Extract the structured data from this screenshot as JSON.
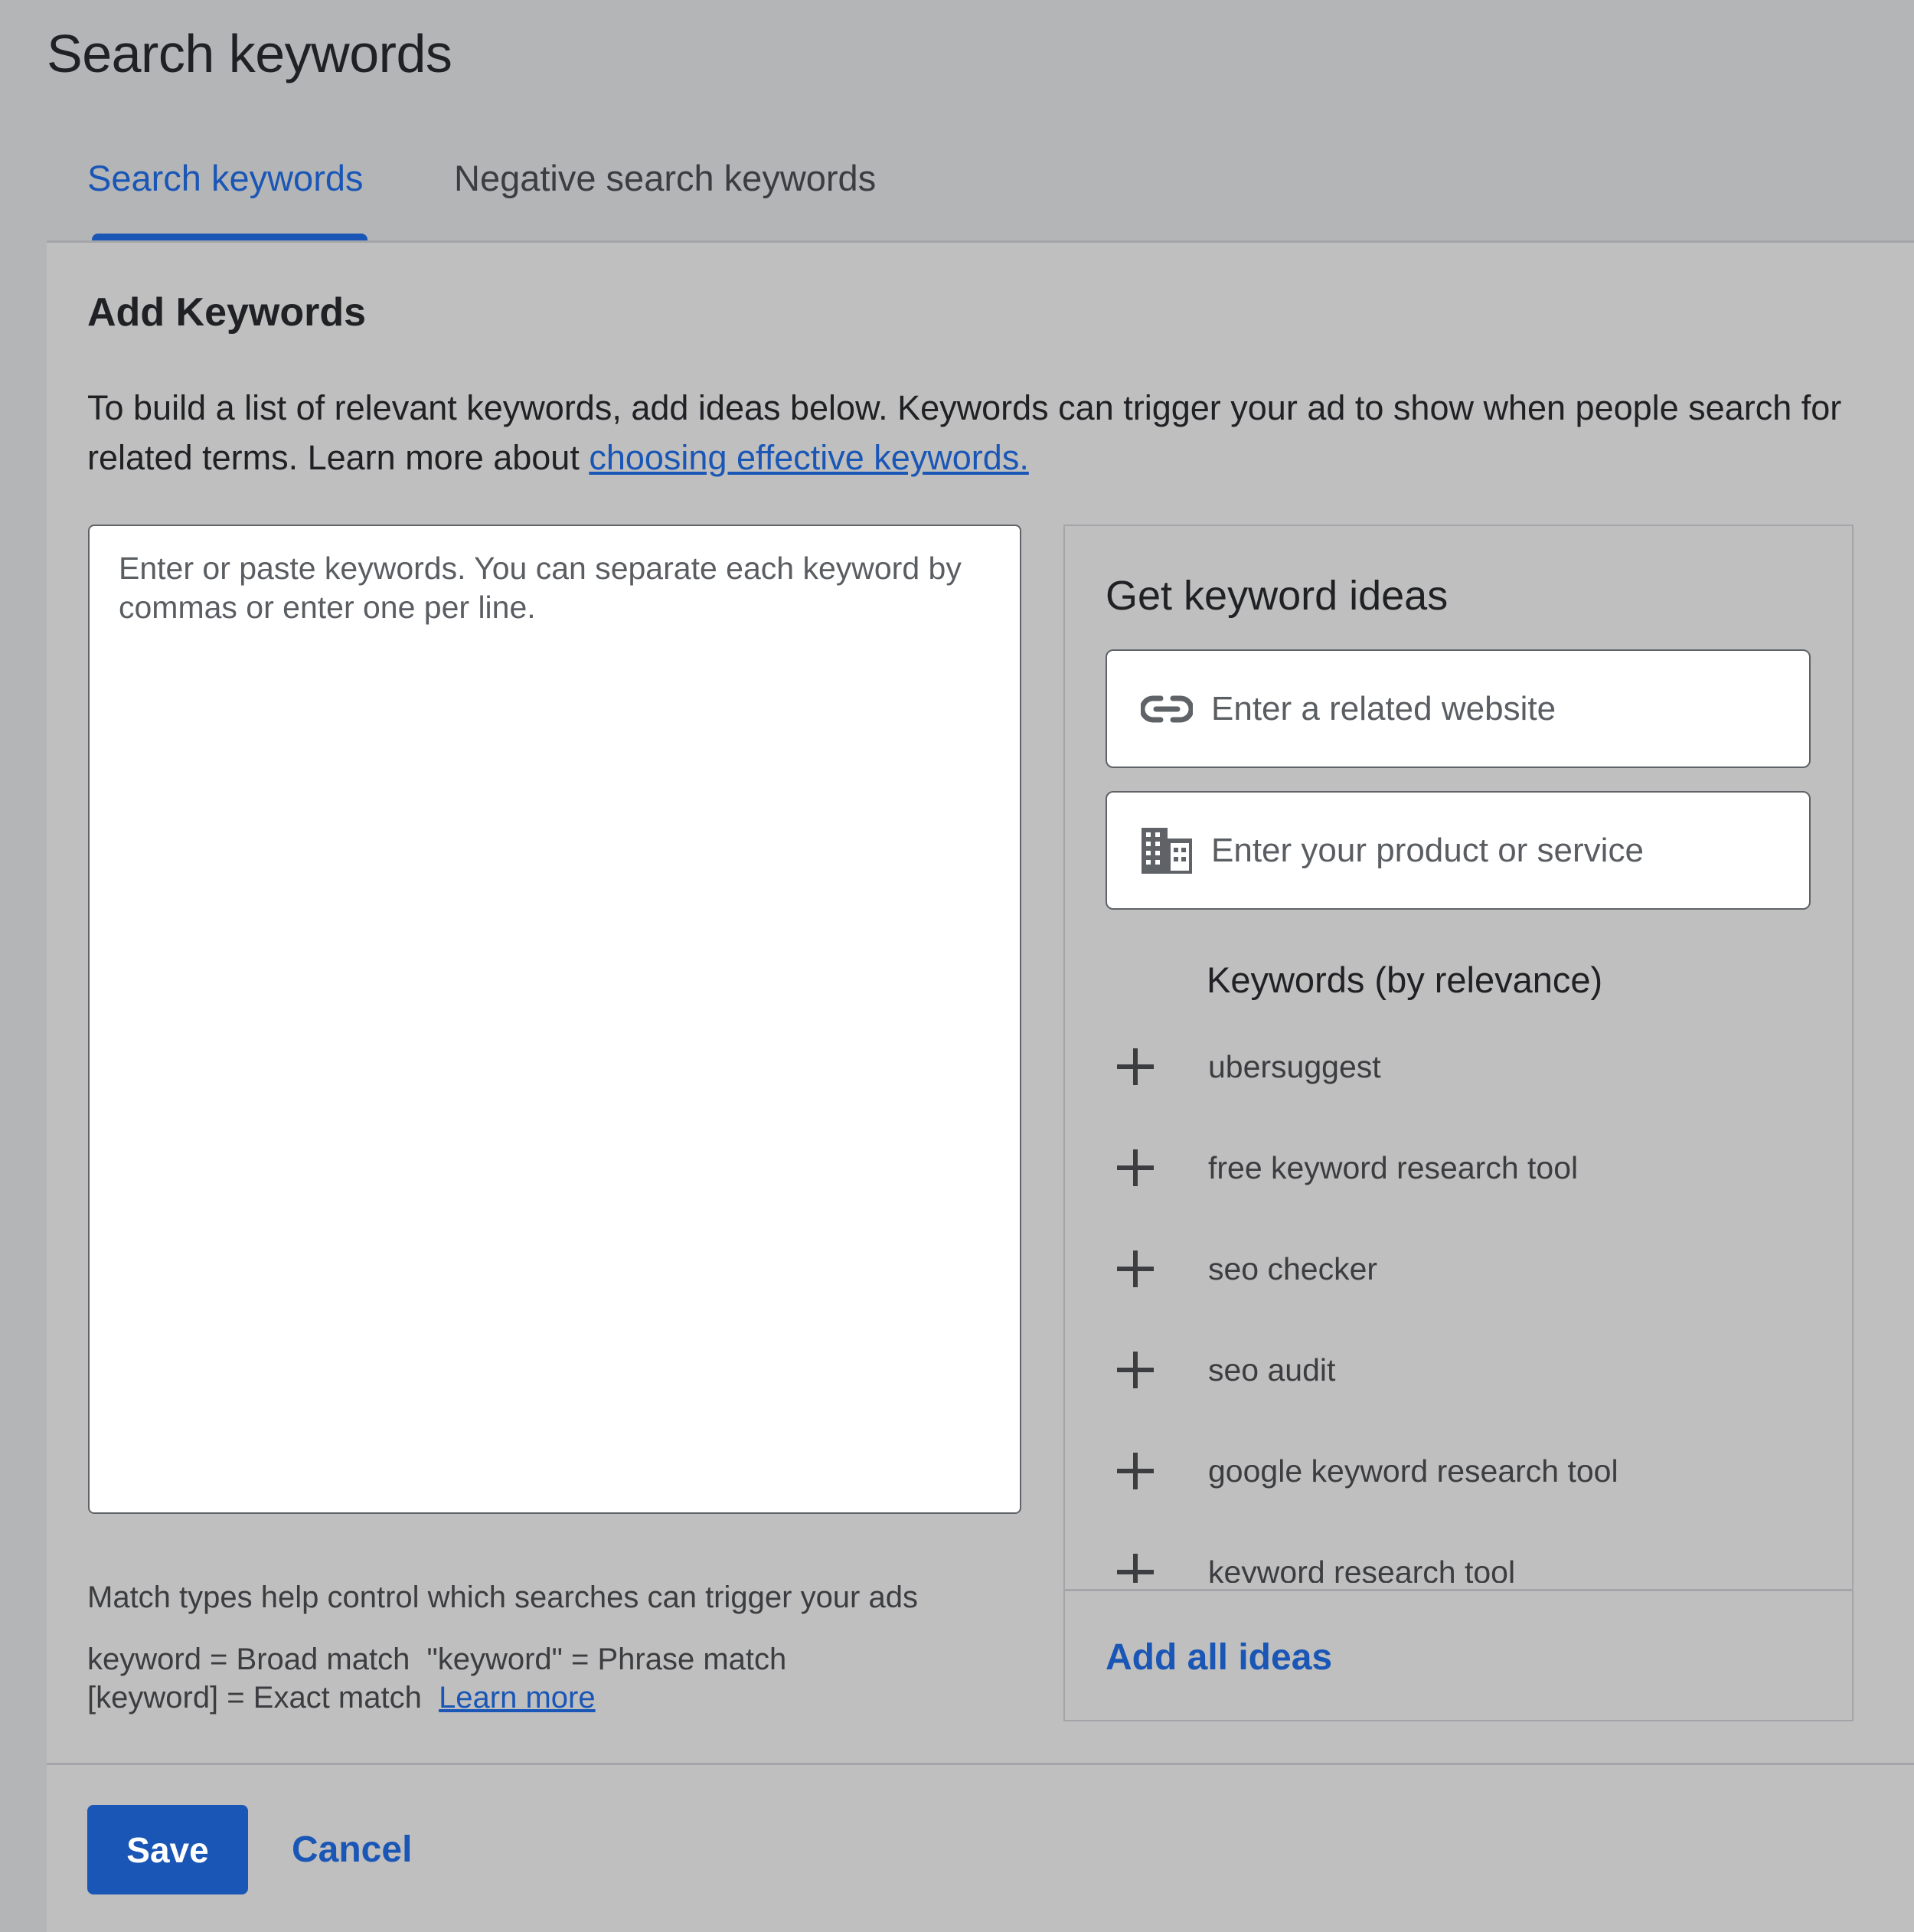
{
  "page": {
    "title": "Search keywords"
  },
  "tabs": [
    {
      "label": "Search keywords",
      "active": true
    },
    {
      "label": "Negative search keywords",
      "active": false
    }
  ],
  "add_keywords": {
    "title": "Add Keywords",
    "description_prefix": "To build a list of relevant keywords, add ideas below. Keywords can trigger your ad to show when people search for related terms. Learn more about ",
    "description_link": "choosing effective keywords.",
    "textarea": {
      "value": "",
      "placeholder": "Enter or paste keywords. You can separate each keyword by commas or enter one per line."
    }
  },
  "keyword_ideas": {
    "title": "Get keyword ideas",
    "website_input": {
      "value": "",
      "placeholder": "Enter a related website",
      "icon": "link-icon"
    },
    "product_input": {
      "value": "",
      "placeholder": "Enter your product or service",
      "icon": "building-icon"
    },
    "list_header": "Keywords (by relevance)",
    "keywords": [
      {
        "text": "ubersuggest",
        "icon": "plus-icon"
      },
      {
        "text": "free keyword research tool",
        "icon": "plus-icon"
      },
      {
        "text": "seo checker",
        "icon": "plus-icon"
      },
      {
        "text": "seo audit",
        "icon": "plus-icon"
      },
      {
        "text": "google keyword research tool",
        "icon": "plus-icon"
      },
      {
        "text": "keyword research tool",
        "icon": "plus-icon"
      }
    ],
    "add_all_label": "Add all ideas"
  },
  "match_types": {
    "help": "Match types help control which searches can trigger your ads",
    "line1": "keyword = Broad match  \"keyword\" = Phrase match",
    "line2": "[keyword] = Exact match  ",
    "learn_more": "Learn more"
  },
  "footer": {
    "save_label": "Save",
    "cancel_label": "Cancel"
  },
  "colors": {
    "accent": "#1a56b5",
    "background": "#b4b5b7",
    "panel": "#bfbfbf"
  }
}
